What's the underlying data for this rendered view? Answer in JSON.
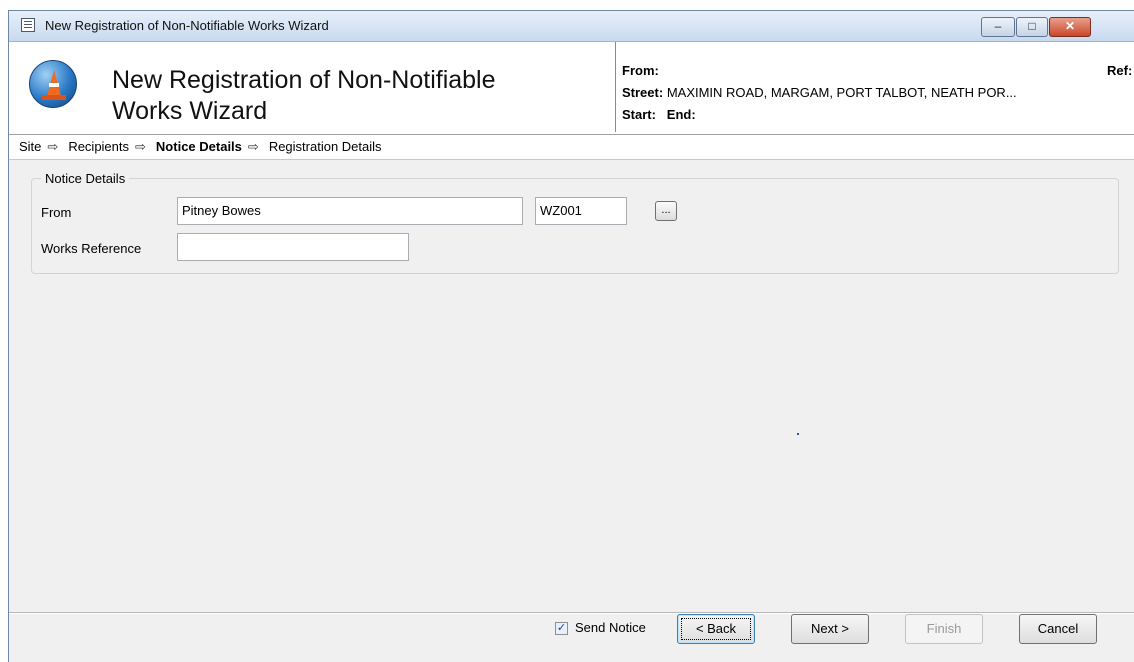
{
  "window": {
    "title": "New Registration of Non-Notifiable Works Wizard"
  },
  "window_controls": {
    "minimize": "–",
    "maximize": "□",
    "close": "✕"
  },
  "header": {
    "title": "New Registration of Non-Notifiable Works Wizard",
    "from_label": "From:",
    "ref_label": "Ref:",
    "street_label": "Street:",
    "street_value": "MAXIMIN ROAD, MARGAM, PORT TALBOT, NEATH POR...",
    "start_label": "Start:",
    "end_label": "End:"
  },
  "steps": {
    "items": [
      "Site",
      "Recipients",
      "Notice Details",
      "Registration Details"
    ],
    "arrow": "⇨",
    "current": "Notice Details"
  },
  "notice_details": {
    "group_label": "Notice Details",
    "from_label": "From",
    "from_value": "Pitney Bowes",
    "from_code": "WZ001",
    "browse_label": "...",
    "works_ref_label": "Works Reference",
    "works_ref_value": ""
  },
  "footer": {
    "send_notice_label": "Send Notice",
    "send_notice_checked": true,
    "check_mark": "✓",
    "back_label": "< Back",
    "next_label": "Next >",
    "finish_label": "Finish",
    "cancel_label": "Cancel"
  }
}
